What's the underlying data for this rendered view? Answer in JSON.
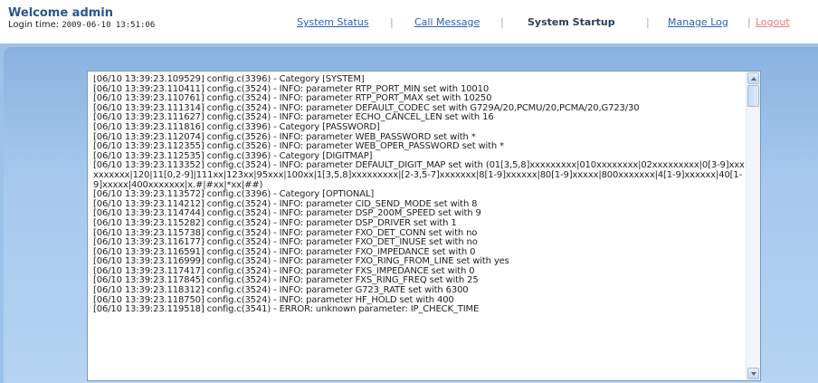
{
  "header": {
    "welcome": "Welcome admin",
    "login_label": "Login time:",
    "login_time": "2009-06-10 13:51:06"
  },
  "nav": {
    "system_status": "System Status",
    "call_message": "Call Message",
    "system_startup": "System Startup",
    "manage_log": "Manage Log",
    "logout": "Logout",
    "separator": "|"
  },
  "log": {
    "lines": [
      "[06/10 13:39:23.109529] config.c(3396) - Category [SYSTEM]",
      "[06/10 13:39:23.110411] config.c(3524) - INFO: parameter RTP_PORT_MIN set with 10010",
      "[06/10 13:39:23.110761] config.c(3524) - INFO: parameter RTP_PORT_MAX set with 10250",
      "[06/10 13:39:23.111314] config.c(3524) - INFO: parameter DEFAULT_CODEC set with G729A/20,PCMU/20,PCMA/20,G723/30",
      "[06/10 13:39:23.111627] config.c(3524) - INFO: parameter ECHO_CANCEL_LEN set with 16",
      "[06/10 13:39:23.111816] config.c(3396) - Category [PASSWORD]",
      "[06/10 13:39:23.112074] config.c(3526) - INFO: parameter WEB_PASSWORD set with *",
      "[06/10 13:39:23.112355] config.c(3526) - INFO: parameter WEB_OPER_PASSWORD set with *",
      "[06/10 13:39:23.112535] config.c(3396) - Category [DIGITMAP]",
      "[06/10 13:39:23.113352] config.c(3524) - INFO: parameter DEFAULT_DIGIT_MAP set with (01[3,5,8]xxxxxxxxx|010xxxxxxxx|02xxxxxxxxx|0[3-9]xxxxxxxxxx|120|11[0,2-9]|111xx|123xx|95xxx|100xx|1[3,5,8]xxxxxxxxx|[2-3,5-7]xxxxxxx|8[1-9]xxxxxx|80[1-9]xxxxx|800xxxxxxx|4[1-9]xxxxxx|40[1-9]xxxxx|400xxxxxxx|x.#|#xx|*xx|##)",
      "[06/10 13:39:23.113572] config.c(3396) - Category [OPTIONAL]",
      "[06/10 13:39:23.114212] config.c(3524) - INFO: parameter CID_SEND_MODE set with 8",
      "[06/10 13:39:23.114744] config.c(3524) - INFO: parameter DSP_200M_SPEED set with 9",
      "[06/10 13:39:23.115282] config.c(3524) - INFO: parameter DSP_DRIVER set with 1",
      "[06/10 13:39:23.115738] config.c(3524) - INFO: parameter FXO_DET_CONN set with no",
      "[06/10 13:39:23.116177] config.c(3524) - INFO: parameter FXO_DET_INUSE set with no",
      "[06/10 13:39:23.116591] config.c(3524) - INFO: parameter FXO_IMPEDANCE set with 0",
      "[06/10 13:39:23.116999] config.c(3524) - INFO: parameter FXO_RING_FROM_LINE set with yes",
      "[06/10 13:39:23.117417] config.c(3524) - INFO: parameter FXS_IMPEDANCE set with 0",
      "[06/10 13:39:23.117845] config.c(3524) - INFO: parameter FXS_RING_FREQ set with 25",
      "[06/10 13:39:23.118312] config.c(3524) - INFO: parameter G723_RATE set with 6300",
      "[06/10 13:39:23.118750] config.c(3524) - INFO: parameter HF_HOLD set with 400",
      "[06/10 13:39:23.119518] config.c(3541) - ERROR: unknown parameter: IP_CHECK_TIME"
    ]
  }
}
